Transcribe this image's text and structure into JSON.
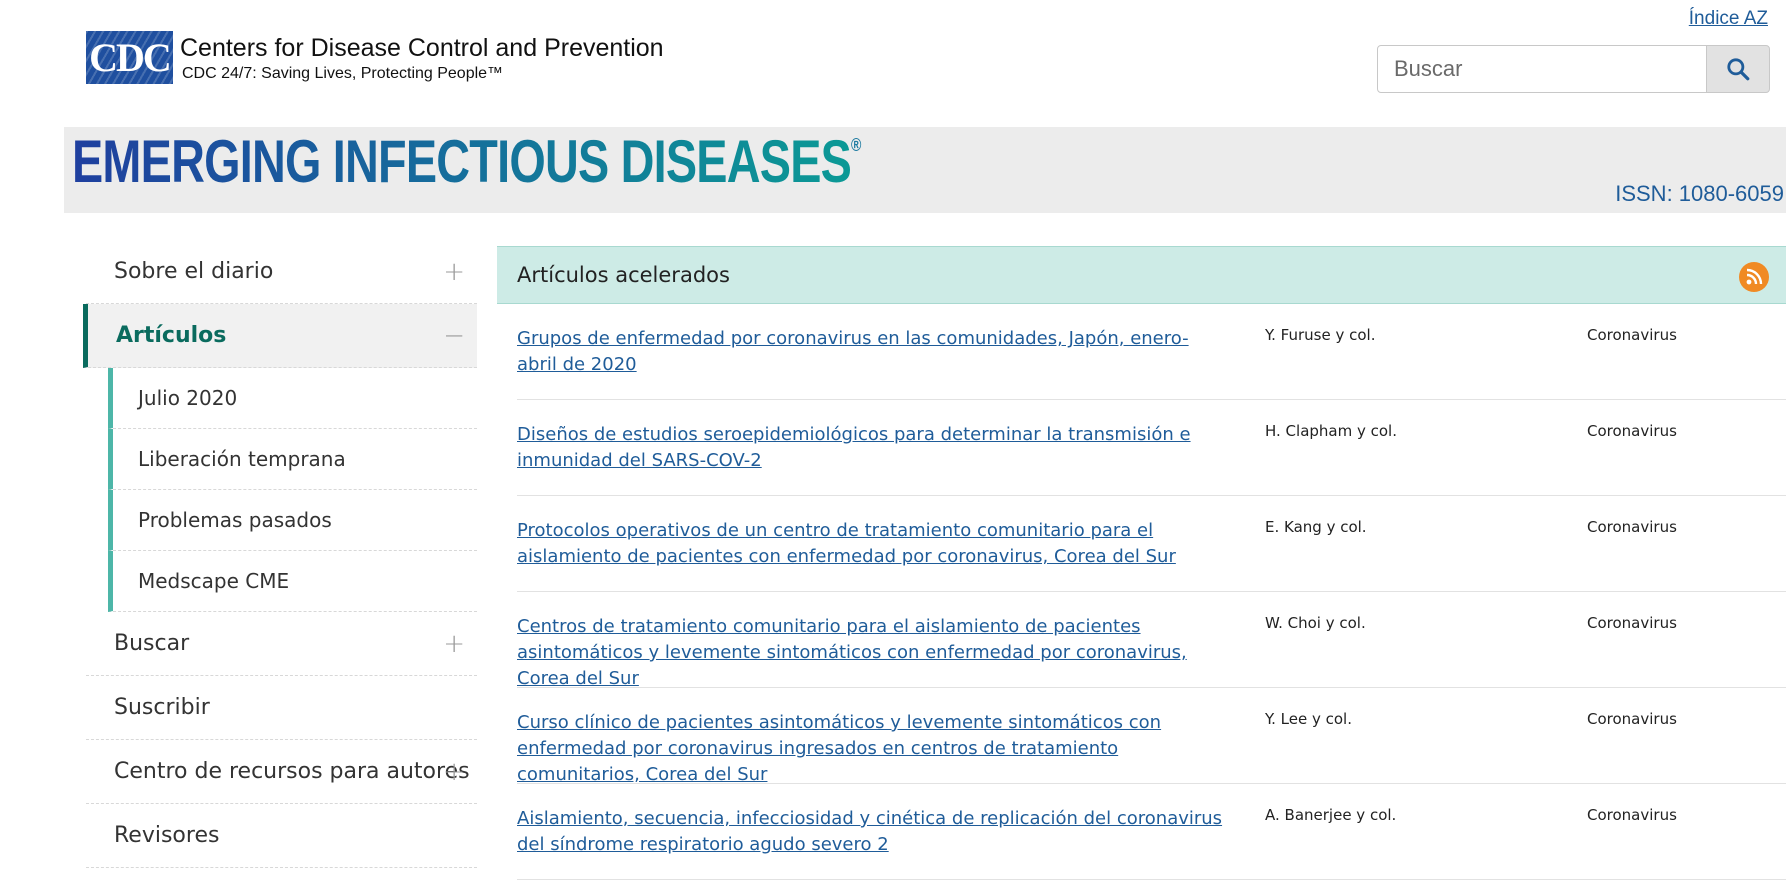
{
  "header": {
    "logo_text": "CDC",
    "org_name": "Centers for Disease Control and Prevention",
    "tagline": "CDC 24/7: Saving Lives, Protecting People™",
    "az_link": "Índice AZ",
    "search_placeholder": "Buscar",
    "search_icon": "search-icon"
  },
  "banner": {
    "title": "EMERGING INFECTIOUS DISEASES",
    "registered": "®",
    "issn": "ISSN: 1080-6059"
  },
  "sidebar": {
    "items": [
      {
        "label": "Sobre el diario",
        "toggle": "+"
      },
      {
        "label": "Artículos",
        "toggle": "−"
      },
      {
        "label": "Buscar",
        "toggle": "+"
      },
      {
        "label": "Suscribir",
        "toggle": ""
      },
      {
        "label": "Centro de recursos para autores",
        "toggle": "+"
      },
      {
        "label": "Revisores",
        "toggle": ""
      }
    ],
    "subitems": [
      {
        "label": "Julio 2020"
      },
      {
        "label": "Liberación temprana"
      },
      {
        "label": "Problemas pasados"
      },
      {
        "label": "Medscape CME"
      }
    ]
  },
  "main": {
    "heading": "Artículos acelerados",
    "rss_icon": "rss-icon",
    "accent": "#cdebe6",
    "articles": [
      {
        "title": "Grupos de enfermedad por coronavirus en las comunidades, Japón, enero-abril de 2020",
        "author": "Y. Furuse y col.",
        "category": "Coronavirus"
      },
      {
        "title": "Diseños de estudios seroepidemiológicos para determinar la transmisión e inmunidad del SARS-COV-2",
        "author": "H. Clapham y col.",
        "category": "Coronavirus"
      },
      {
        "title": "Protocolos operativos de un centro de tratamiento comunitario para el aislamiento de pacientes con enfermedad por coronavirus, Corea del Sur",
        "author": "E. Kang y col.",
        "category": "Coronavirus"
      },
      {
        "title": "Centros de tratamiento comunitario para el aislamiento de pacientes asintomáticos y levemente sintomáticos con enfermedad por coronavirus, Corea del Sur",
        "author": "W. Choi y col.",
        "category": "Coronavirus"
      },
      {
        "title": "Curso clínico de pacientes asintomáticos y levemente sintomáticos con enfermedad por coronavirus ingresados en centros de tratamiento comunitarios, Corea del Sur",
        "author": "Y. Lee y col.",
        "category": "Coronavirus"
      },
      {
        "title": "Aislamiento, secuencia, infecciosidad y cinética de replicación del coronavirus del síndrome respiratorio agudo severo 2",
        "author": "A. Banerjee y col.",
        "category": "Coronavirus"
      }
    ]
  }
}
